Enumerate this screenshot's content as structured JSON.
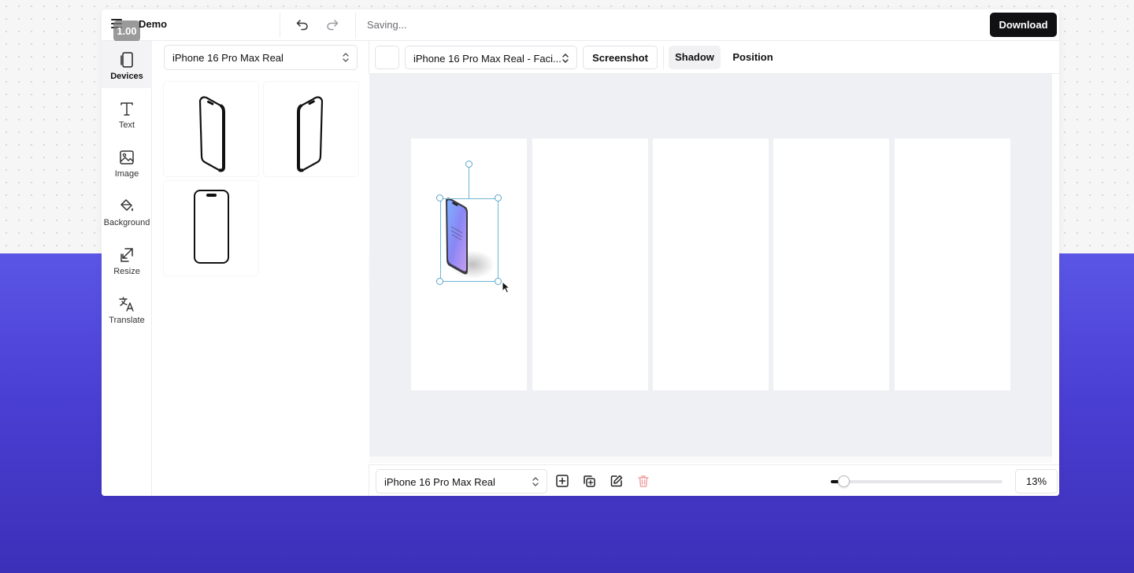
{
  "app": {
    "project_name": "Demo",
    "version_badge": "1.00",
    "status": "Saving...",
    "download_label": "Download"
  },
  "rail": {
    "items": [
      {
        "label": "Devices",
        "icon": "device-icon",
        "active": true
      },
      {
        "label": "Text",
        "icon": "text-icon"
      },
      {
        "label": "Image",
        "icon": "image-icon"
      },
      {
        "label": "Background",
        "icon": "paint-bucket-icon"
      },
      {
        "label": "Resize",
        "icon": "resize-icon"
      },
      {
        "label": "Translate",
        "icon": "translate-icon"
      }
    ]
  },
  "panel": {
    "device_select": "iPhone 16 Pro Max Real",
    "tiles": [
      {
        "icon": "phone-tilted-left-icon"
      },
      {
        "icon": "phone-tilted-right-icon"
      },
      {
        "icon": "phone-front-icon"
      }
    ]
  },
  "toolbar": {
    "style_select": "iPhone 16 Pro Max Real - Faci...",
    "screenshot_label": "Screenshot",
    "shadow_label": "Shadow",
    "position_label": "Position",
    "swatch_color": "#ffffff"
  },
  "canvas": {
    "background": "#eef0f4",
    "frame_count": 5
  },
  "bottombar": {
    "device_select": "iPhone 16 Pro Max Real",
    "zoom": 0.13,
    "zoom_label": "13%"
  },
  "colors": {
    "accent_dark": "#111114",
    "selection": "#6fb5d6",
    "background_gradient_top": "#5b56e6",
    "background_gradient_bottom": "#3c2fb8"
  }
}
